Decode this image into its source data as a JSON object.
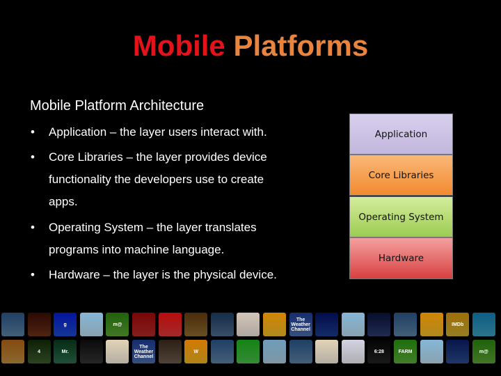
{
  "title": {
    "word1": "Mobile",
    "word2": "Platforms",
    "color1": "#e4121b",
    "color2": "#e8843e"
  },
  "subtitle": "Mobile Platform Architecture",
  "bullets": [
    {
      "lines": [
        "Application – the layer users interact with."
      ]
    },
    {
      "lines": [
        "Core Libraries – the layer provides device",
        "functionality the developers use to create",
        "apps."
      ]
    },
    {
      "lines": [
        "Operating System – the layer translates",
        "programs into machine language."
      ]
    },
    {
      "lines": [
        "Hardware – the layer is the physical device."
      ]
    }
  ],
  "bullet_symbol": "•",
  "stack": [
    {
      "label": "Application",
      "color": "#cfc6e6"
    },
    {
      "label": "Core Libraries",
      "color": "#f7a255"
    },
    {
      "label": "Operating System",
      "color": "#b8dc74"
    },
    {
      "label": "Hardware",
      "color": "#ee7b7b"
    }
  ],
  "icon_rows": [
    [
      {
        "c": "#5a7fa0",
        "t": ""
      },
      {
        "c": "#6a3018",
        "t": ""
      },
      {
        "c": "#1d48c8",
        "t": "g"
      },
      {
        "c": "#b8d8ea",
        "t": ""
      },
      {
        "c": "#5a9e34",
        "t": "m@"
      },
      {
        "c": "#b02828",
        "t": ""
      },
      {
        "c": "#d83838",
        "t": ""
      },
      {
        "c": "#8a6a30",
        "t": ""
      },
      {
        "c": "#4a6a8a",
        "t": ""
      },
      {
        "c": "#e8e0d8",
        "t": ""
      },
      {
        "c": "#e8b828",
        "t": ""
      },
      {
        "c": "#4a6aa8",
        "t": "The Weather Channel"
      },
      {
        "c": "#1a3a8a",
        "t": ""
      },
      {
        "c": "#b8d8ea",
        "t": ""
      },
      {
        "c": "#2a3a6a",
        "t": ""
      },
      {
        "c": "#5a7fa0",
        "t": ""
      },
      {
        "c": "#e8b828",
        "t": ""
      },
      {
        "c": "#c8a830",
        "t": "IMDb"
      },
      {
        "c": "#3a9ab8",
        "t": ""
      }
    ],
    [
      {
        "c": "#b88a40",
        "t": ""
      },
      {
        "c": "#3a5a2a",
        "t": "4"
      },
      {
        "c": "#2a6a4a",
        "t": "Mr."
      },
      {
        "c": "#333333",
        "t": ""
      },
      {
        "c": "#f0e8d8",
        "t": ""
      },
      {
        "c": "#4a6aa8",
        "t": "The Weather Channel"
      },
      {
        "c": "#6a5a4a",
        "t": ""
      },
      {
        "c": "#e8b020",
        "t": "W"
      },
      {
        "c": "#5a7fa0",
        "t": ""
      },
      {
        "c": "#48b848",
        "t": ""
      },
      {
        "c": "#a8c8da",
        "t": ""
      },
      {
        "c": "#5a7fa0",
        "t": ""
      },
      {
        "c": "#f0e8d8",
        "t": ""
      },
      {
        "c": "#e8e8f0",
        "t": ""
      },
      {
        "c": "#222222",
        "t": "6:28"
      },
      {
        "c": "#58a838",
        "t": "FARM"
      },
      {
        "c": "#b8d8ea",
        "t": ""
      },
      {
        "c": "#2a4a8a",
        "t": ""
      },
      {
        "c": "#5a9e34",
        "t": "m@"
      }
    ]
  ]
}
